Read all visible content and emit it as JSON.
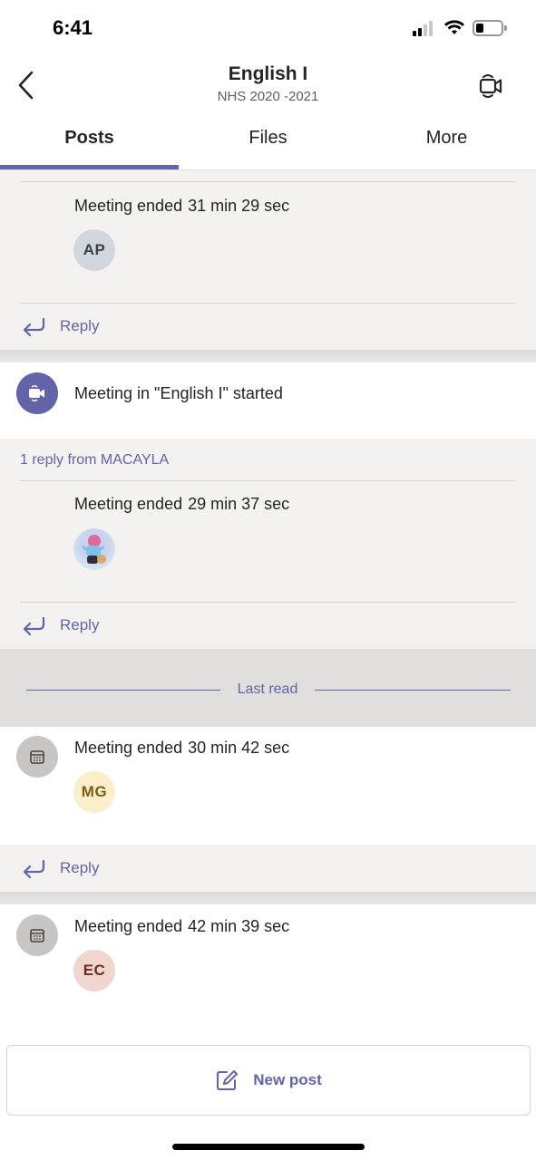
{
  "status_bar": {
    "time": "6:41"
  },
  "header": {
    "title": "English I",
    "subtitle": "NHS 2020 -2021"
  },
  "tabs": [
    {
      "label": "Posts",
      "active": true
    },
    {
      "label": "Files",
      "active": false
    },
    {
      "label": "More",
      "active": false
    }
  ],
  "feed": {
    "reply_label": "Reply",
    "thread1": {
      "event": "Meeting ended",
      "duration": "31 min 29 sec",
      "avatar_initials": "AP"
    },
    "thread2": {
      "started_text": "Meeting in \"English I\" started",
      "replies_link": "1 reply from MACAYLA",
      "event": "Meeting ended",
      "duration": "29 min 37 sec"
    },
    "last_read_label": "Last read",
    "thread3": {
      "event": "Meeting ended",
      "duration": "30 min 42 sec",
      "avatar_initials": "MG"
    },
    "thread4": {
      "event": "Meeting ended",
      "duration": "42 min 39 sec",
      "avatar_initials": "EC"
    }
  },
  "new_post_label": "New post",
  "colors": {
    "accent": "#6264a7",
    "feed_background": "#f3f2f1",
    "avatar_ap": "#d2d7dd",
    "avatar_mg": "#fbeecb",
    "avatar_ec": "#f1d6cf"
  }
}
